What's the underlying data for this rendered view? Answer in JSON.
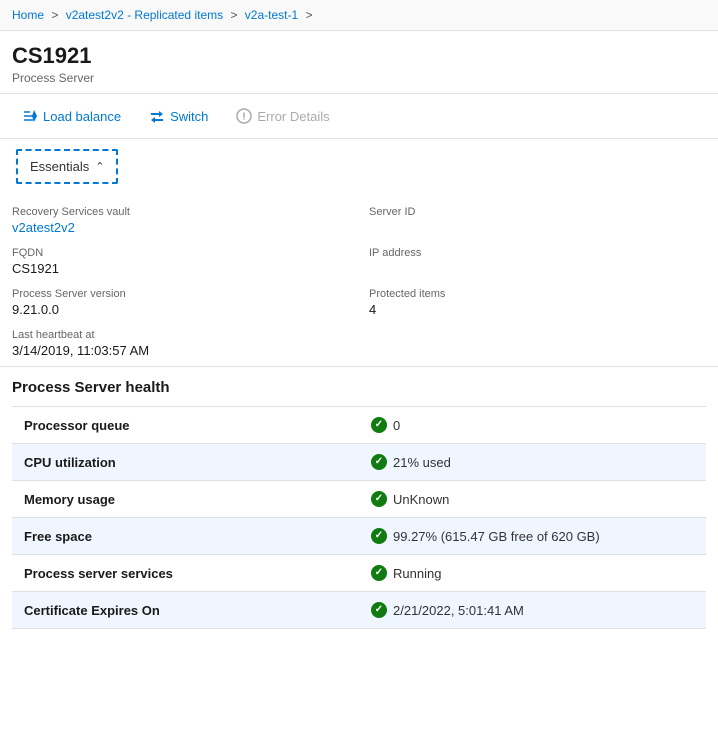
{
  "breadcrumb": {
    "items": [
      {
        "label": "Home",
        "link": true
      },
      {
        "label": "v2atest2v2 - Replicated items",
        "link": true
      },
      {
        "label": "v2a-test-1",
        "link": true
      }
    ],
    "separator": ">"
  },
  "header": {
    "title": "CS1921",
    "subtitle": "Process Server"
  },
  "toolbar": {
    "load_balance_label": "Load balance",
    "switch_label": "Switch",
    "error_details_label": "Error Details"
  },
  "essentials": {
    "label": "Essentials"
  },
  "details": {
    "recovery_services_vault_label": "Recovery Services vault",
    "recovery_services_vault_value": "v2atest2v2",
    "server_id_label": "Server ID",
    "server_id_value": "",
    "fqdn_label": "FQDN",
    "fqdn_value": "CS1921",
    "ip_address_label": "IP address",
    "ip_address_value": "",
    "process_server_version_label": "Process Server version",
    "process_server_version_value": "9.21.0.0",
    "protected_items_label": "Protected items",
    "protected_items_value": "4",
    "last_heartbeat_label": "Last heartbeat at",
    "last_heartbeat_value": "3/14/2019, 11:03:57 AM"
  },
  "health": {
    "section_title": "Process Server health",
    "rows": [
      {
        "label": "Processor queue",
        "value": "0",
        "status": "ok"
      },
      {
        "label": "CPU utilization",
        "value": "21% used",
        "status": "ok"
      },
      {
        "label": "Memory usage",
        "value": "UnKnown",
        "status": "ok"
      },
      {
        "label": "Free space",
        "value": "99.27% (615.47 GB free of 620 GB)",
        "status": "ok"
      },
      {
        "label": "Process server services",
        "value": "Running",
        "status": "ok"
      },
      {
        "label": "Certificate Expires On",
        "value": "2/21/2022, 5:01:41 AM",
        "status": "ok"
      }
    ]
  }
}
